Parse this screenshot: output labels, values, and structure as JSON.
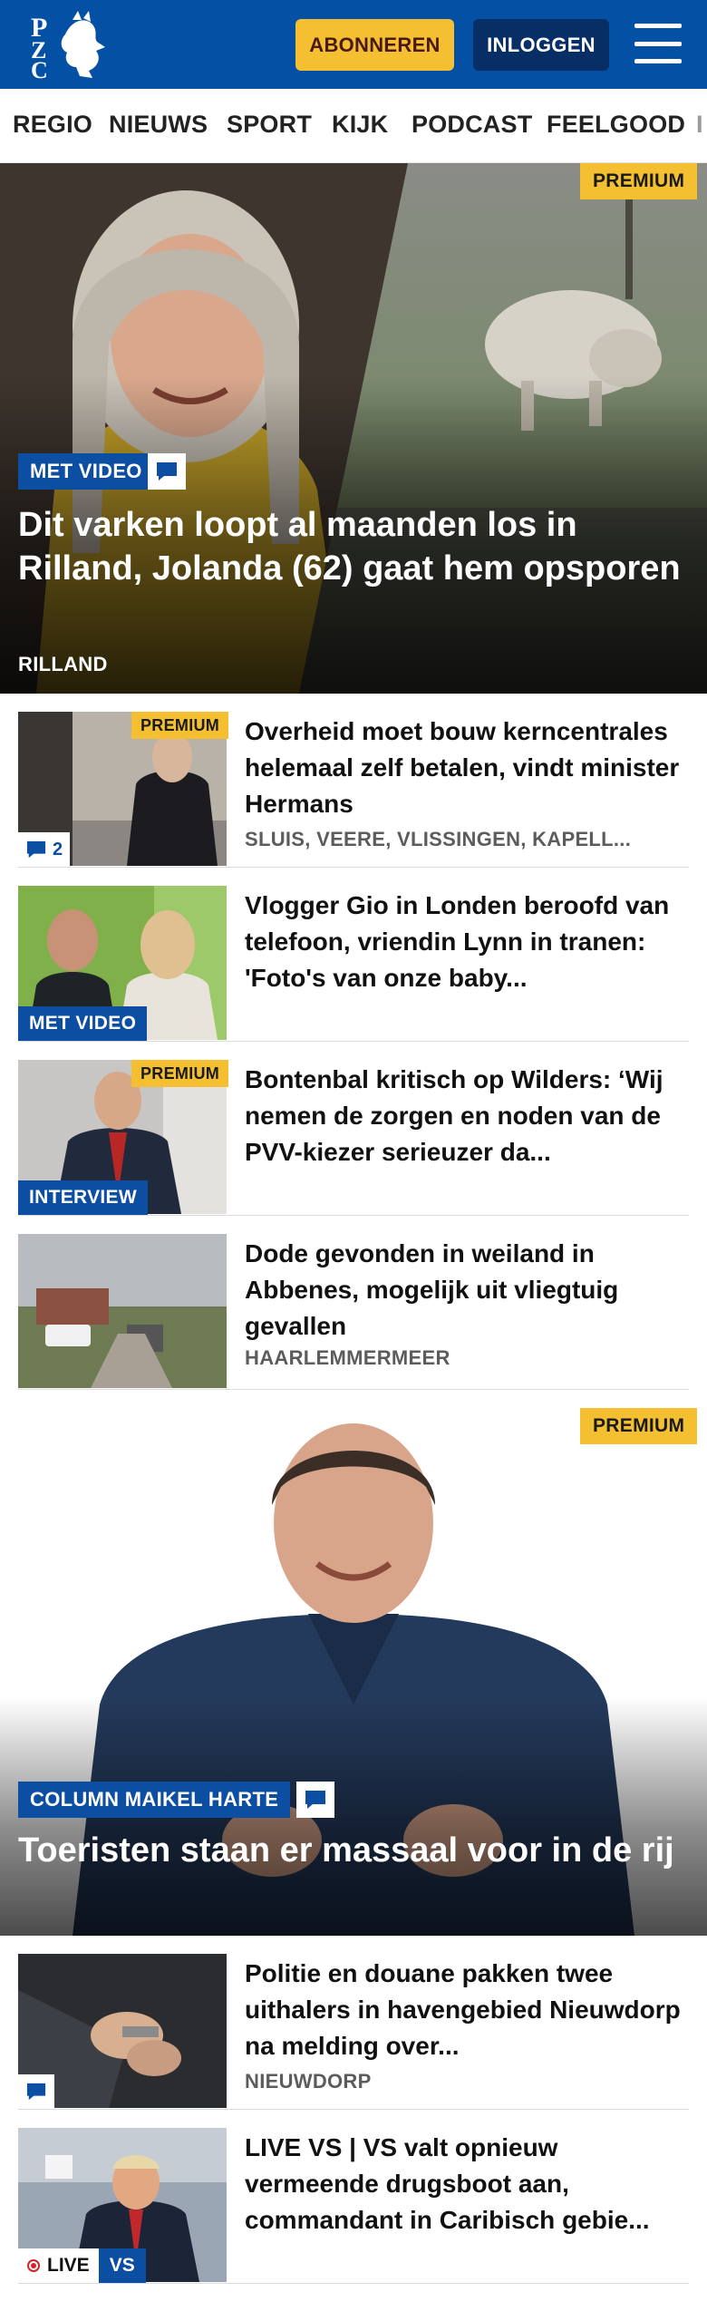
{
  "header": {
    "logo_letters": "PZC",
    "subscribe_label": "ABONNEREN",
    "login_label": "INLOGGEN"
  },
  "nav": {
    "items": [
      "REGIO",
      "NIEUWS",
      "SPORT",
      "KIJK",
      "PODCAST",
      "FEELGOOD",
      "I"
    ]
  },
  "hero": {
    "badge": "PREMIUM",
    "tag": "MET VIDEO",
    "title": "Dit varken loopt al maanden los in Rilland, Jolanda (62) gaat hem opsporen",
    "location": "RILLAND"
  },
  "articles": [
    {
      "badge": "PREMIUM",
      "comment_count": "2",
      "title": "Overheid moet bouw kerncentrales helemaal zelf betalen, vindt minister Hermans",
      "location": "SLUIS, VEERE, VLISSINGEN, KAPELL..."
    },
    {
      "tag": "MET VIDEO",
      "title": "Vlogger Gio in Londen beroofd van telefoon, vriendin Lynn in tranen: 'Foto's van onze baby..."
    },
    {
      "badge": "PREMIUM",
      "tag": "INTERVIEW",
      "title": "Bontenbal kritisch op Wilders: ‘Wij nemen de zorgen en noden van de PVV-kiezer serieuzer da..."
    },
    {
      "title": "Dode gevonden in weiland in Abbenes, mogelijk uit vliegtuig gevallen",
      "location": "HAARLEMMERMEER"
    }
  ],
  "column": {
    "badge": "PREMIUM",
    "tag": "COLUMN MAIKEL HARTE",
    "title": "Toeristen staan er massaal voor in de rij"
  },
  "articles_2": [
    {
      "title": "Politie en douane pakken twee uithalers in havengebied Nieuwdorp na melding over...",
      "location": "NIEUWDORP"
    },
    {
      "live_label": "LIVE",
      "vs_label": "VS",
      "title": "LIVE VS | VS valt opnieuw vermeende drugsboot aan, commandant in Caribisch gebie..."
    }
  ],
  "colors": {
    "brand_blue": "#0350a5",
    "subscribe_yellow": "#f4c032",
    "tag_blue": "#0b4ea2",
    "live_red": "#d2232a"
  }
}
